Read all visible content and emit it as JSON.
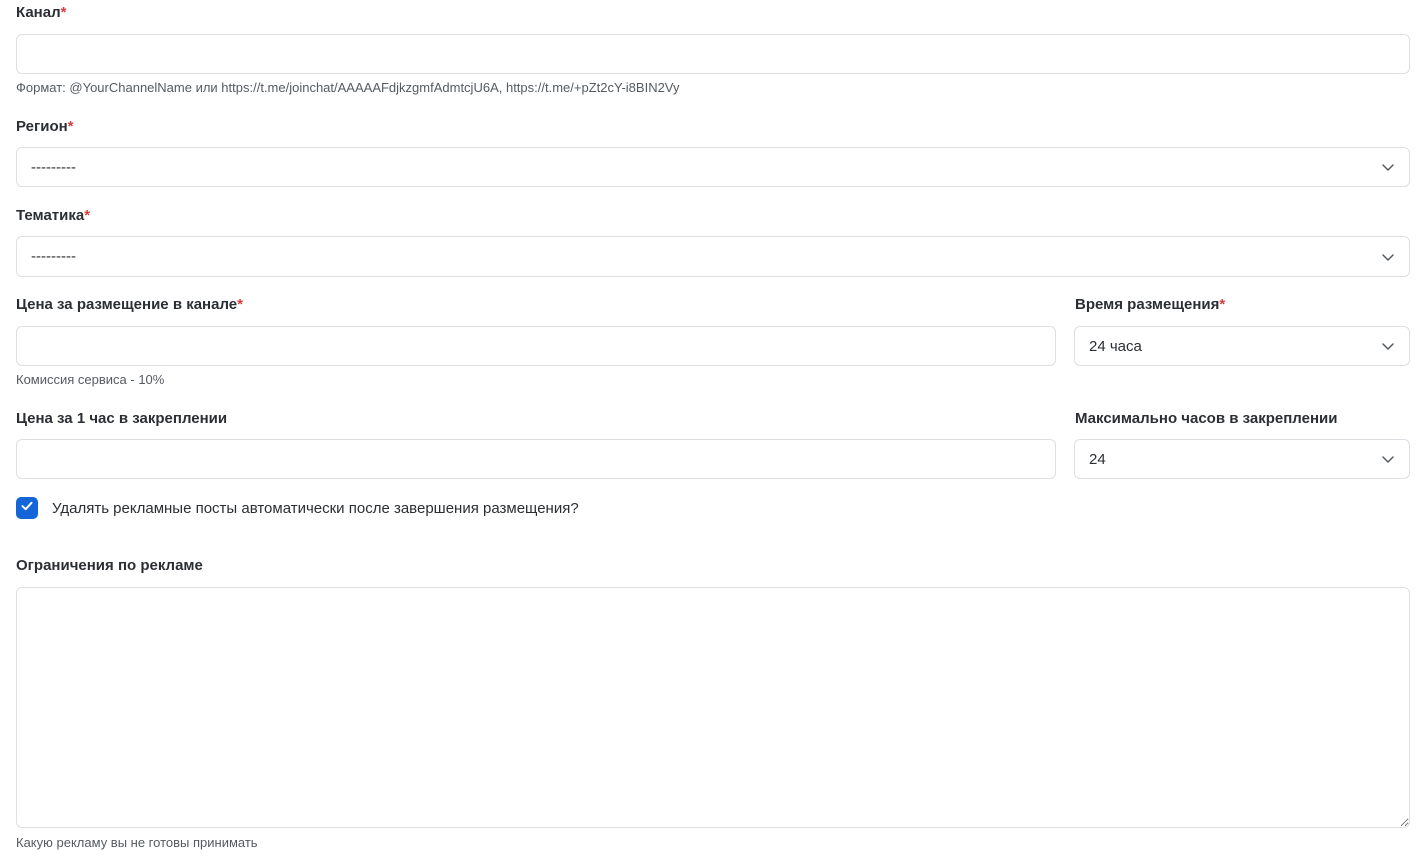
{
  "channel": {
    "label": "Канал",
    "required_mark": "*",
    "value": "",
    "hint": "Формат: @YourChannelName или https://t.me/joinchat/AAAAAFdjkzgmfAdmtcjU6A, https://t.me/+pZt2cY-i8BIN2Vy"
  },
  "region": {
    "label": "Регион",
    "required_mark": "*",
    "selected": "---------"
  },
  "topic": {
    "label": "Тематика",
    "required_mark": "*",
    "selected": "---------"
  },
  "placement_price": {
    "label": "Цена за размещение в канале",
    "required_mark": "*",
    "value": "",
    "hint": "Комиссия сервиса - 10%"
  },
  "placement_time": {
    "label": "Время размещения",
    "required_mark": "*",
    "selected": "24 часа"
  },
  "pin_price": {
    "label": "Цена за 1 час в закреплении",
    "value": ""
  },
  "max_pin_hours": {
    "label": "Максимально часов в закреплении",
    "selected": "24"
  },
  "auto_delete": {
    "label": "Удалять рекламные посты автоматически после завершения размещения?",
    "checked": true
  },
  "ad_restrictions": {
    "label": "Ограничения по рекламе",
    "value": "",
    "hint": "Какую рекламу вы не готовы принимать"
  },
  "colors": {
    "accent": "#1466d8",
    "required": "#d93a3a",
    "border": "#dcdfe3"
  },
  "icons": {
    "select_chevron": "chevron-down-icon",
    "checkbox_check": "check-icon",
    "resize_handle": "resize-handle-icon"
  }
}
